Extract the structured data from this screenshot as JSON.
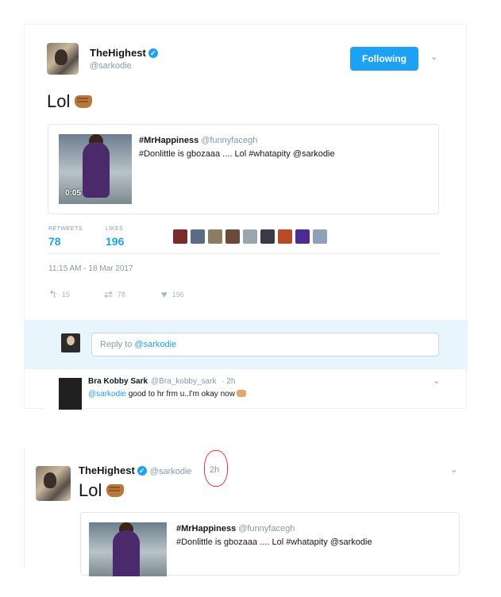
{
  "tweet": {
    "display_name": "TheHighest",
    "handle": "@sarkodie",
    "follow_label": "Following",
    "text": "Lol",
    "quote": {
      "name": "#MrHappiness",
      "handle": "@funnyfacegh",
      "text": "#Donlittle is gbozaaa .... Lol #whatapity @sarkodie",
      "duration": "0:05"
    },
    "stats": {
      "retweets_label": "RETWEETS",
      "retweets": "78",
      "likes_label": "LIKES",
      "likes": "196"
    },
    "timestamp": "11:15 AM - 18 Mar 2017",
    "actions": {
      "replies": "15",
      "retweets": "78",
      "likes": "196"
    }
  },
  "reply_box": {
    "prefix": "Reply to",
    "mention": "@sarkodie"
  },
  "reply": {
    "name": "Bra Kobby Sark",
    "handle": "@Bra_kobby_sark",
    "time": "· 2h",
    "mention": "@sarkodie",
    "text": "good to hr frm u..I'm okay now"
  },
  "timeline_tweet": {
    "display_name": "TheHighest",
    "handle": "@sarkodie",
    "time": "2h",
    "text": "Lol",
    "quote": {
      "name": "#MrHappiness",
      "handle": "@funnyfacegh",
      "text": "#Donlittle is gbozaaa .... Lol #whatapity @sarkodie"
    }
  },
  "colors": {
    "accent": "#1da1f2",
    "annotation": "#e33333",
    "reply_bar": "#e8f5fd"
  },
  "icons": {
    "verified": "verified-badge-icon",
    "reply": "reply-icon",
    "retweet": "retweet-icon",
    "like": "heart-icon",
    "chevron": "chevron-down-icon"
  }
}
